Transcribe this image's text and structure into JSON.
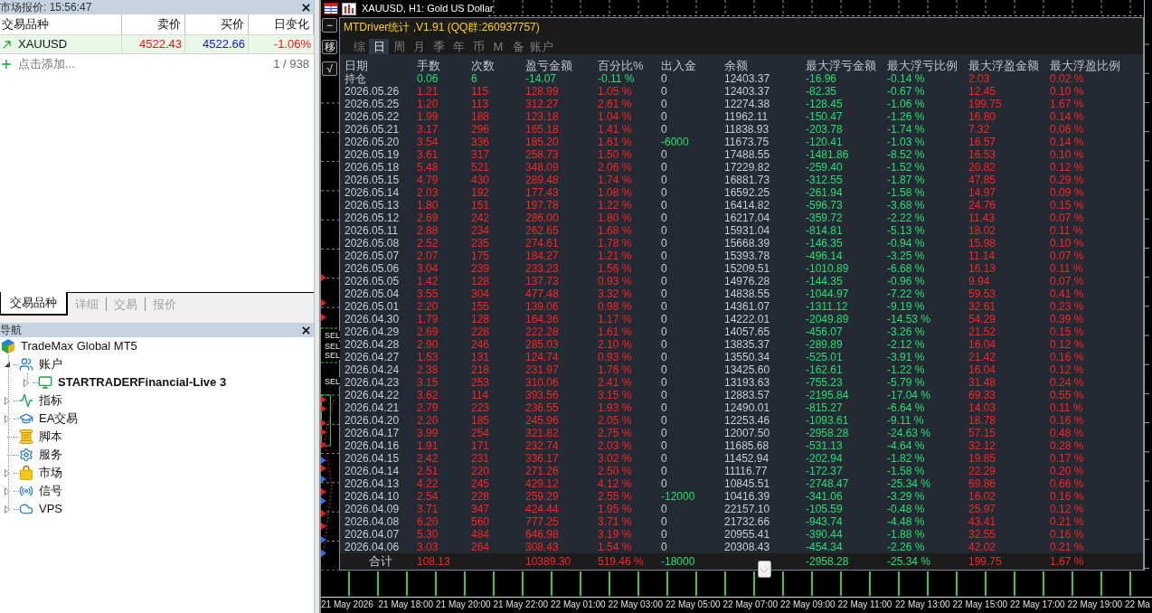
{
  "market_watch": {
    "title": "市场报价: 15:56:47",
    "columns": [
      "交易品种",
      "卖价",
      "买价",
      "日变化"
    ],
    "rows": [
      {
        "symbol": "XAUUSD",
        "bid": "4522.43",
        "ask": "4522.66",
        "change": "-1.06%"
      }
    ],
    "add_row": {
      "label": "点击添加...",
      "count": "1 / 938"
    },
    "tabs": [
      {
        "label": "交易品种",
        "selected": true
      },
      {
        "label": "详细",
        "selected": false
      },
      {
        "label": "交易",
        "selected": false
      },
      {
        "label": "报价",
        "selected": false
      }
    ]
  },
  "navigator": {
    "title": "导航",
    "tree": [
      {
        "label": "TradeMax Global MT5",
        "children": [
          {
            "label": "账户",
            "expanded": true,
            "children": [
              {
                "label": "STARTRADERFinancial-Live 3",
                "expanded": false,
                "active": true
              }
            ]
          },
          {
            "label": "指标",
            "expanded": false
          },
          {
            "label": "EA交易",
            "expanded": false
          },
          {
            "label": "脚本"
          },
          {
            "label": "服务"
          },
          {
            "label": "市场",
            "expanded": false
          },
          {
            "label": "信号",
            "expanded": false
          },
          {
            "label": "VPS",
            "expanded": false
          }
        ]
      }
    ]
  },
  "chart": {
    "title": "XAUUSD, H1: Gold US Dollar",
    "side_buttons": [
      "−",
      "移",
      "√"
    ],
    "object_labels": [
      "SEL",
      "SEL",
      "SEL",
      "SEL"
    ],
    "time_axis": [
      "21 May 2026",
      "21 May 18:00",
      "21 May 20:00",
      "21 May 22:00",
      "22 May 01:00",
      "22 May 03:00",
      "22 May 05:00",
      "22 May 07:00",
      "22 May 09:00",
      "22 May 11:00",
      "22 May 13:00",
      "22 May 15:00",
      "22 May 17:00",
      "22 May 19:00",
      "22 Ma"
    ]
  },
  "stats_panel": {
    "title": "MTDriver统计 ,V1.91 (QQ群:260937757)",
    "tabs": [
      {
        "label": "综",
        "selected": false
      },
      {
        "label": "日",
        "selected": true
      },
      {
        "label": "周",
        "selected": false
      },
      {
        "label": "月",
        "selected": false
      },
      {
        "label": "季",
        "selected": false
      },
      {
        "label": "年",
        "selected": false
      },
      {
        "label": "币",
        "selected": false
      },
      {
        "label": "M",
        "selected": false
      },
      {
        "label": "备",
        "selected": false
      },
      {
        "label": "账户",
        "selected": false
      }
    ],
    "columns": [
      "日期",
      "手数",
      "次数",
      "盈亏金额",
      "百分比%",
      "出入金",
      "余额",
      "最大浮亏金额",
      "最大浮亏比例",
      "最大浮盈金额",
      "最大浮盈比例"
    ],
    "position_row": [
      "持仓",
      "0.06",
      "6",
      "-14.07",
      "-0.11 %",
      "0",
      "12403.37",
      "-16.96",
      "-0.14 %",
      "2.03",
      "0.02 %"
    ],
    "rows": [
      [
        "2026.05.26",
        "1.21",
        "115",
        "128.99",
        "1.05 %",
        "0",
        "12403.37",
        "-82.35",
        "-0.67 %",
        "12.45",
        "0.10 %"
      ],
      [
        "2026.05.25",
        "1.20",
        "113",
        "312.27",
        "2.61 %",
        "0",
        "12274.38",
        "-128.45",
        "-1.06 %",
        "199.75",
        "1.67 %"
      ],
      [
        "2026.05.22",
        "1.99",
        "188",
        "123.18",
        "1.04 %",
        "0",
        "11962.11",
        "-150.47",
        "-1.26 %",
        "16.80",
        "0.14 %"
      ],
      [
        "2026.05.21",
        "3.17",
        "296",
        "165.18",
        "1.41 %",
        "0",
        "11838.93",
        "-203.78",
        "-1.74 %",
        "7.32",
        "0.06 %"
      ],
      [
        "2026.05.20",
        "3.54",
        "336",
        "185.20",
        "1.61 %",
        "-6000",
        "11673.75",
        "-120.41",
        "-1.03 %",
        "16.57",
        "0.14 %"
      ],
      [
        "2026.05.19",
        "3.61",
        "317",
        "258.73",
        "1.50 %",
        "0",
        "17488.55",
        "-1481.86",
        "-8.52 %",
        "16.53",
        "0.10 %"
      ],
      [
        "2026.05.18",
        "5.48",
        "521",
        "348.09",
        "2.06 %",
        "0",
        "17229.82",
        "-259.40",
        "-1.52 %",
        "20.82",
        "0.12 %"
      ],
      [
        "2026.05.15",
        "4.79",
        "430",
        "289.48",
        "1.74 %",
        "0",
        "16881.73",
        "-312.55",
        "-1.87 %",
        "47.85",
        "0.29 %"
      ],
      [
        "2026.05.14",
        "2.03",
        "192",
        "177.43",
        "1.08 %",
        "0",
        "16592.25",
        "-261.94",
        "-1.58 %",
        "14.97",
        "0.09 %"
      ],
      [
        "2026.05.13",
        "1.80",
        "151",
        "197.78",
        "1.22 %",
        "0",
        "16414.82",
        "-596.73",
        "-3.68 %",
        "24.76",
        "0.15 %"
      ],
      [
        "2026.05.12",
        "2.69",
        "242",
        "286.00",
        "1.80 %",
        "0",
        "16217.04",
        "-359.72",
        "-2.22 %",
        "11.43",
        "0.07 %"
      ],
      [
        "2026.05.11",
        "2.88",
        "234",
        "262.65",
        "1.68 %",
        "0",
        "15931.04",
        "-814.81",
        "-5.13 %",
        "18.02",
        "0.11 %"
      ],
      [
        "2026.05.08",
        "2.52",
        "235",
        "274.61",
        "1.78 %",
        "0",
        "15668.39",
        "-146.35",
        "-0.94 %",
        "15.98",
        "0.10 %"
      ],
      [
        "2026.05.07",
        "2.07",
        "175",
        "184.27",
        "1.21 %",
        "0",
        "15393.78",
        "-496.14",
        "-3.25 %",
        "11.14",
        "0.07 %"
      ],
      [
        "2026.05.06",
        "3.04",
        "239",
        "233.23",
        "1.56 %",
        "0",
        "15209.51",
        "-1010.89",
        "-6.68 %",
        "16.13",
        "0.11 %"
      ],
      [
        "2026.05.05",
        "1.42",
        "128",
        "137.73",
        "0.93 %",
        "0",
        "14976.28",
        "-144.35",
        "-0.96 %",
        "9.94",
        "0.07 %"
      ],
      [
        "2026.05.04",
        "3.55",
        "304",
        "477.48",
        "3.32 %",
        "0",
        "14838.55",
        "-1044.97",
        "-7.22 %",
        "59.53",
        "0.41 %"
      ],
      [
        "2026.05.01",
        "2.20",
        "155",
        "139.06",
        "0.98 %",
        "0",
        "14361.07",
        "-1311.12",
        "-9.19 %",
        "32.61",
        "0.23 %"
      ],
      [
        "2026.04.30",
        "1.79",
        "128",
        "164.36",
        "1.17 %",
        "0",
        "14222.01",
        "-2049.89",
        "-14.53 %",
        "54.29",
        "0.39 %"
      ],
      [
        "2026.04.29",
        "2.69",
        "228",
        "222.28",
        "1.61 %",
        "0",
        "14057.65",
        "-456.07",
        "-3.26 %",
        "21.52",
        "0.15 %"
      ],
      [
        "2026.04.28",
        "2.90",
        "246",
        "285.03",
        "2.10 %",
        "0",
        "13835.37",
        "-289.89",
        "-2.12 %",
        "16.04",
        "0.12 %"
      ],
      [
        "2026.04.27",
        "1.53",
        "131",
        "124.74",
        "0.93 %",
        "0",
        "13550.34",
        "-525.01",
        "-3.91 %",
        "21.42",
        "0.16 %"
      ],
      [
        "2026.04.24",
        "2.38",
        "218",
        "231.97",
        "1.76 %",
        "0",
        "13425.60",
        "-162.61",
        "-1.22 %",
        "16.04",
        "0.12 %"
      ],
      [
        "2026.04.23",
        "3.15",
        "253",
        "310.06",
        "2.41 %",
        "0",
        "13193.63",
        "-755.23",
        "-5.79 %",
        "31.48",
        "0.24 %"
      ],
      [
        "2026.04.22",
        "3.62",
        "114",
        "393.56",
        "3.15 %",
        "0",
        "12883.57",
        "-2195.84",
        "-17.04 %",
        "69.33",
        "0.55 %"
      ],
      [
        "2026.04.21",
        "2.79",
        "223",
        "236.55",
        "1.93 %",
        "0",
        "12490.01",
        "-815.27",
        "-6.64 %",
        "14.03",
        "0.11 %"
      ],
      [
        "2026.04.20",
        "2.20",
        "185",
        "245.96",
        "2.05 %",
        "0",
        "12253.46",
        "-1093.61",
        "-9.11 %",
        "18.78",
        "0.16 %"
      ],
      [
        "2026.04.17",
        "3.99",
        "254",
        "321.82",
        "2.75 %",
        "0",
        "12007.50",
        "-2958.28",
        "-24.63 %",
        "57.15",
        "0.48 %"
      ],
      [
        "2026.04.16",
        "1.91",
        "171",
        "232.74",
        "2.03 %",
        "0",
        "11685.68",
        "-531.13",
        "-4.64 %",
        "32.12",
        "0.28 %"
      ],
      [
        "2026.04.15",
        "2.42",
        "231",
        "336.17",
        "3.02 %",
        "0",
        "11452.94",
        "-202.94",
        "-1.82 %",
        "19.85",
        "0.17 %"
      ],
      [
        "2026.04.14",
        "2.51",
        "220",
        "271.26",
        "2.50 %",
        "0",
        "11116.77",
        "-172.37",
        "-1.58 %",
        "22.29",
        "0.20 %"
      ],
      [
        "2026.04.13",
        "4.22",
        "245",
        "429.12",
        "4.12 %",
        "0",
        "10845.51",
        "-2748.47",
        "-25.34 %",
        "69.86",
        "0.66 %"
      ],
      [
        "2026.04.10",
        "2.54",
        "228",
        "259.29",
        "2.55 %",
        "-12000",
        "10416.39",
        "-341.06",
        "-3.29 %",
        "16.02",
        "0.16 %"
      ],
      [
        "2026.04.09",
        "3.71",
        "347",
        "424.44",
        "1.95 %",
        "0",
        "22157.10",
        "-105.59",
        "-0.48 %",
        "25.97",
        "0.12 %"
      ],
      [
        "2026.04.08",
        "6.20",
        "560",
        "777.25",
        "3.71 %",
        "0",
        "21732.66",
        "-943.74",
        "-4.48 %",
        "43.41",
        "0.21 %"
      ],
      [
        "2026.04.07",
        "5.30",
        "484",
        "646.98",
        "3.19 %",
        "0",
        "20955.41",
        "-390.44",
        "-1.88 %",
        "32.55",
        "0.16 %"
      ],
      [
        "2026.04.06",
        "3.03",
        "264",
        "308.43",
        "1.54 %",
        "0",
        "20308.43",
        "-454.34",
        "-2.26 %",
        "42.02",
        "0.21 %"
      ]
    ],
    "totals": {
      "label": "合计",
      "lots": "108.13",
      "profit": "10389.30",
      "percent": "519.46 %",
      "deposit": "-18000",
      "max_loss": "-2958.28",
      "max_loss_ratio": "-25.34 %",
      "max_profit": "199.75",
      "max_profit_ratio": "1.67 %"
    }
  }
}
